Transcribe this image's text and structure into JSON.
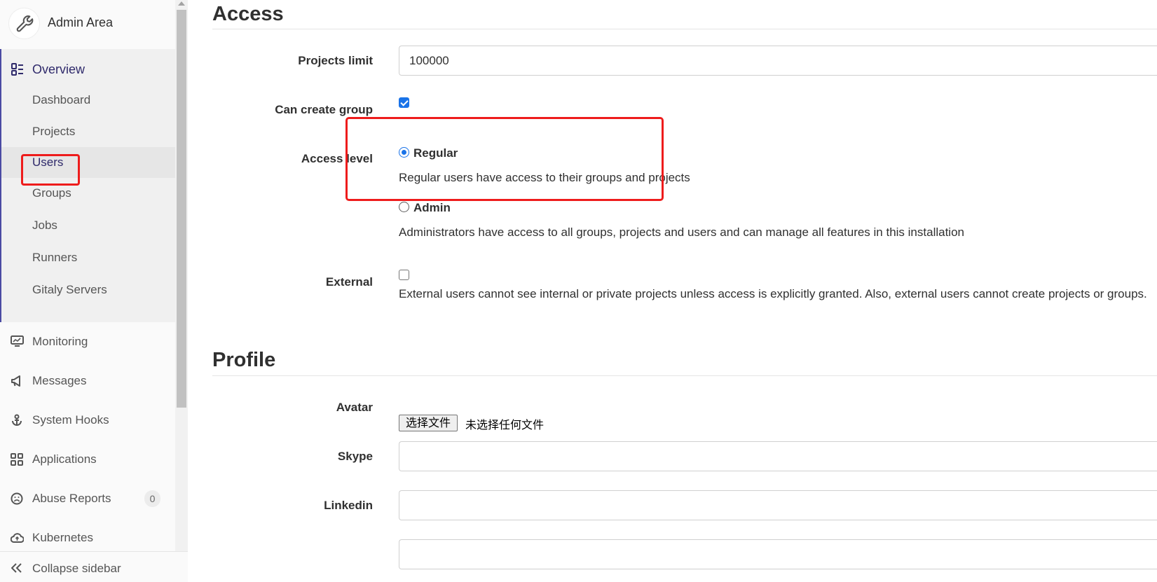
{
  "sidebar": {
    "title": "Admin Area",
    "overview": {
      "label": "Overview",
      "items": [
        {
          "label": "Dashboard"
        },
        {
          "label": "Projects"
        },
        {
          "label": "Users"
        },
        {
          "label": "Groups"
        },
        {
          "label": "Jobs"
        },
        {
          "label": "Runners"
        },
        {
          "label": "Gitaly Servers"
        }
      ]
    },
    "items": [
      {
        "label": "Monitoring",
        "icon": "monitor-icon"
      },
      {
        "label": "Messages",
        "icon": "megaphone-icon"
      },
      {
        "label": "System Hooks",
        "icon": "anchor-icon"
      },
      {
        "label": "Applications",
        "icon": "applications-icon"
      },
      {
        "label": "Abuse Reports",
        "icon": "abuse-reports-icon",
        "badge": "0"
      },
      {
        "label": "Kubernetes",
        "icon": "kubernetes-icon"
      }
    ],
    "collapse_label": "Collapse sidebar",
    "active_color": "#2f2a6b"
  },
  "access": {
    "title": "Access",
    "projects_limit": {
      "label": "Projects limit",
      "value": "100000"
    },
    "can_create_group": {
      "label": "Can create group",
      "checked": true
    },
    "access_level": {
      "label": "Access level",
      "regular": {
        "title": "Regular",
        "help": "Regular users have access to their groups and projects",
        "selected": true
      },
      "admin": {
        "title": "Admin",
        "help": "Administrators have access to all groups, projects and users and can manage all features in this installation",
        "selected": false
      }
    },
    "external": {
      "label": "External",
      "checked": false,
      "help": "External users cannot see internal or private projects unless access is explicitly granted. Also, external users cannot create projects or groups."
    }
  },
  "profile": {
    "title": "Profile",
    "avatar": {
      "label": "Avatar",
      "button": "选择文件",
      "status": "未选择任何文件"
    },
    "skype": {
      "label": "Skype",
      "value": ""
    },
    "linkedin": {
      "label": "Linkedin",
      "value": ""
    }
  },
  "highlight_color": "#ee1c1c"
}
